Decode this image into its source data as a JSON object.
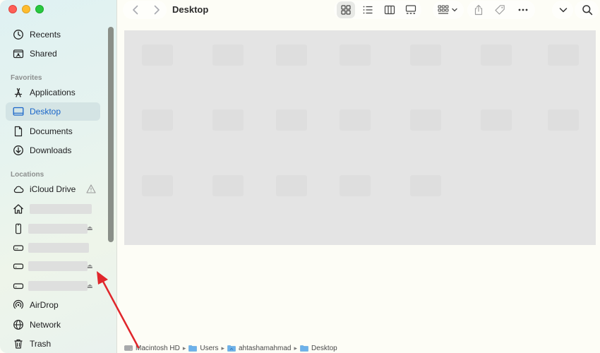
{
  "window": {
    "title": "Desktop"
  },
  "sidebar": {
    "recents": "Recents",
    "shared": "Shared",
    "favorites_header": "Favorites",
    "favorites": [
      {
        "label": "Applications",
        "icon": "applications-icon"
      },
      {
        "label": "Desktop",
        "icon": "desktop-icon",
        "selected": true
      },
      {
        "label": "Documents",
        "icon": "document-icon"
      },
      {
        "label": "Downloads",
        "icon": "download-icon"
      }
    ],
    "locations_header": "Locations",
    "locations": [
      {
        "label": "iCloud Drive",
        "icon": "cloud-icon",
        "warning": true
      },
      {
        "label": "",
        "icon": "home-icon",
        "redacted": true
      },
      {
        "label": "",
        "icon": "iphone-icon",
        "redacted": true,
        "eject": true
      },
      {
        "label": "",
        "icon": "drive-icon",
        "redacted": true
      },
      {
        "label": "",
        "icon": "drive-icon",
        "redacted": true,
        "eject": true
      },
      {
        "label": "",
        "icon": "drive-icon",
        "redacted": true,
        "eject": true
      },
      {
        "label": "AirDrop",
        "icon": "airdrop-icon"
      },
      {
        "label": "Network",
        "icon": "network-icon"
      },
      {
        "label": "Trash",
        "icon": "trash-icon"
      }
    ]
  },
  "toolbar": {
    "view_modes": [
      "icon-view",
      "list-view",
      "column-view",
      "gallery-view"
    ],
    "selected_view": "icon-view",
    "tools": [
      "group-icon",
      "share-icon",
      "tag-icon",
      "more-icon",
      "chevron-down-icon",
      "search-icon"
    ]
  },
  "pathbar": {
    "crumbs": [
      "Macintosh HD",
      "Users",
      "ahtashamahmad",
      "Desktop"
    ]
  },
  "colors": {
    "accent": "#1a66c9",
    "annotation": "#e0262b",
    "content_overlay": "#e4e4e4"
  }
}
